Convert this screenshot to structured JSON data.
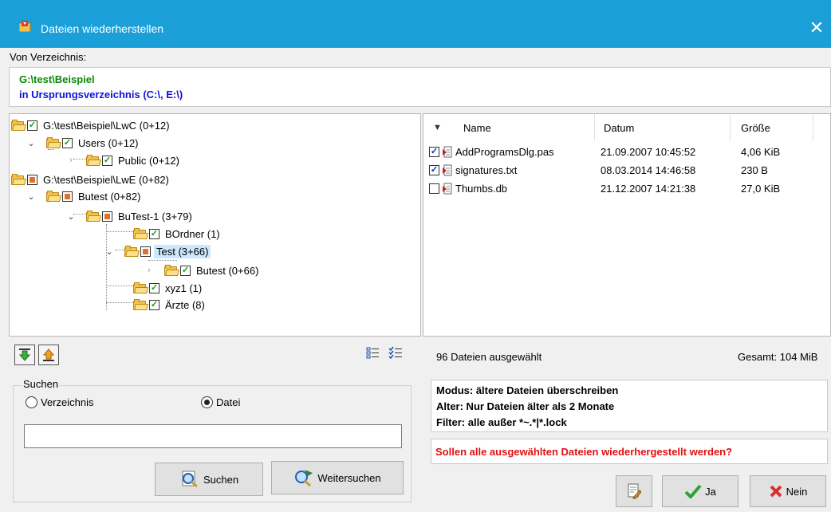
{
  "window": {
    "title": "Dateien wiederherstellen",
    "close_glyph": "✕"
  },
  "source": {
    "label": "Von Verzeichnis:",
    "path": "G:\\test\\Beispiel",
    "target": "in Ursprungsverzeichnis (C:\\, E:\\)"
  },
  "tree": [
    {
      "label": "G:\\test\\Beispiel\\LwC (0+12)"
    },
    {
      "label": "Users (0+12)"
    },
    {
      "label": "Public (0+12)"
    },
    {
      "label": "G:\\test\\Beispiel\\LwE (0+82)"
    },
    {
      "label": "Butest (0+82)"
    },
    {
      "label": "BuTest-1 (3+79)"
    },
    {
      "label": "BOrdner (1)"
    },
    {
      "label": "Test (3+66)"
    },
    {
      "label": "Butest (0+66)"
    },
    {
      "label": "xyz1 (1)"
    },
    {
      "label": "Ärzte (8)"
    }
  ],
  "files": {
    "columns": {
      "name": "Name",
      "date": "Datum",
      "size": "Größe"
    },
    "rows": [
      {
        "name": "AddProgramsDlg.pas",
        "date": "21.09.2007 10:45:52",
        "size": "4,06 KiB",
        "checked": true
      },
      {
        "name": "signatures.txt",
        "date": "08.03.2014 14:46:58",
        "size": "230 B",
        "checked": true
      },
      {
        "name": "Thumbs.db",
        "date": "21.12.2007 14:21:38",
        "size": "27,0 KiB",
        "checked": false
      }
    ]
  },
  "search": {
    "group_label": "Suchen",
    "radio_dir": "Verzeichnis",
    "radio_file": "Datei",
    "selected": "Datei",
    "input_value": "",
    "search_button": "Suchen",
    "next_button": "Weitersuchen"
  },
  "status": {
    "selected_count": "96 Dateien ausgewählt",
    "total": "Gesamt: 104 MiB"
  },
  "mode": {
    "line1": "Modus: ältere Dateien überschreiben",
    "line2": "Alter: Nur Dateien älter als 2 Monate",
    "line3": "Filter: alle außer *~.*|*.lock"
  },
  "question": "Sollen alle ausgewählten Dateien wiederhergestellt werden?",
  "buttons": {
    "yes": "Ja",
    "no": "Nein"
  },
  "colors": {
    "titlebar": "#1a9fd9",
    "path_green": "#0a8a0a",
    "path_blue": "#1010e0",
    "question_red": "#e01010",
    "selection": "#cce8ff"
  }
}
